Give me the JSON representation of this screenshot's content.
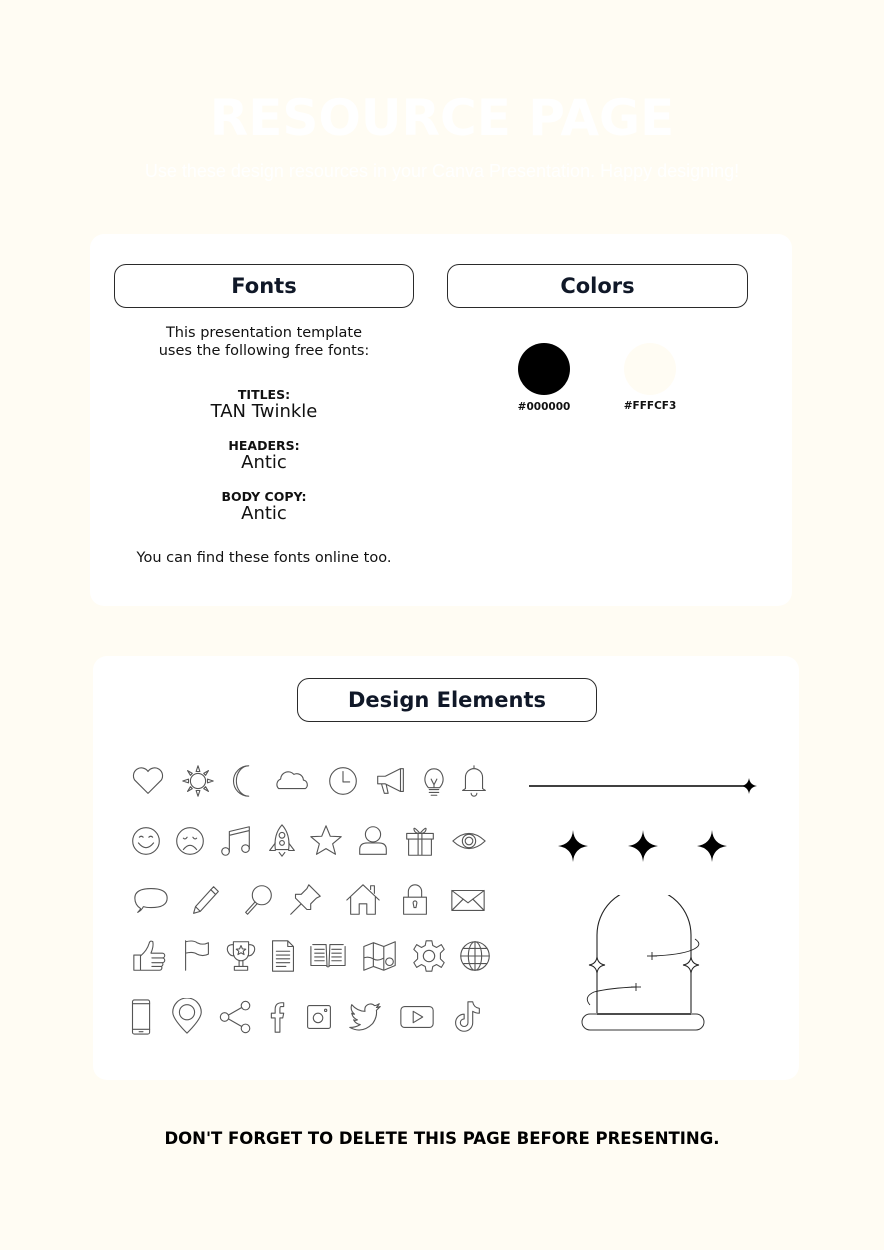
{
  "page": {
    "title": "RESOURCE PAGE",
    "subtitle": "Use these design resources in your Canva Presentation. Happy designing!",
    "background_color": "#FFFCF3",
    "footer_note": "DON'T FORGET TO DELETE THIS PAGE BEFORE PRESENTING."
  },
  "fonts_section": {
    "heading": "Fonts",
    "intro_line1": "This presentation template",
    "intro_line2": "uses the following free fonts:",
    "entries": [
      {
        "label": "TITLES:",
        "font": "TAN Twinkle"
      },
      {
        "label": "HEADERS:",
        "font": "Antic"
      },
      {
        "label": "BODY COPY:",
        "font": "Antic"
      }
    ],
    "footnote": "You can find these fonts online too."
  },
  "colors_section": {
    "heading": "Colors",
    "swatches": [
      {
        "hex": "#000000",
        "label": "#000000"
      },
      {
        "hex": "#FFFCF3",
        "label": "#FFFCF3"
      }
    ]
  },
  "design_section": {
    "heading": "Design Elements",
    "icon_rows": [
      [
        "heart-icon",
        "sun-icon",
        "moon-icon",
        "cloud-icon",
        "clock-icon",
        "megaphone-icon",
        "lightbulb-icon",
        "bell-icon"
      ],
      [
        "smiley-face-icon",
        "sad-face-icon",
        "music-note-icon",
        "rocket-icon",
        "star-icon",
        "user-icon",
        "gift-icon",
        "eye-icon"
      ],
      [
        "speech-bubble-icon",
        "pencil-icon",
        "magnifier-icon",
        "pushpin-icon",
        "house-icon",
        "padlock-icon",
        "envelope-icon"
      ],
      [
        "thumbs-up-icon",
        "flag-icon",
        "trophy-icon",
        "document-icon",
        "open-book-icon",
        "map-icon",
        "gear-icon",
        "globe-icon"
      ],
      [
        "smartphone-icon",
        "location-pin-icon",
        "share-icon",
        "facebook-icon",
        "instagram-icon",
        "twitter-icon",
        "youtube-icon",
        "tiktok-icon"
      ]
    ],
    "decorations": [
      "line-with-sparkle",
      "sparkle",
      "sparkle",
      "sparkle",
      "arch-frame-with-sparkles"
    ]
  }
}
